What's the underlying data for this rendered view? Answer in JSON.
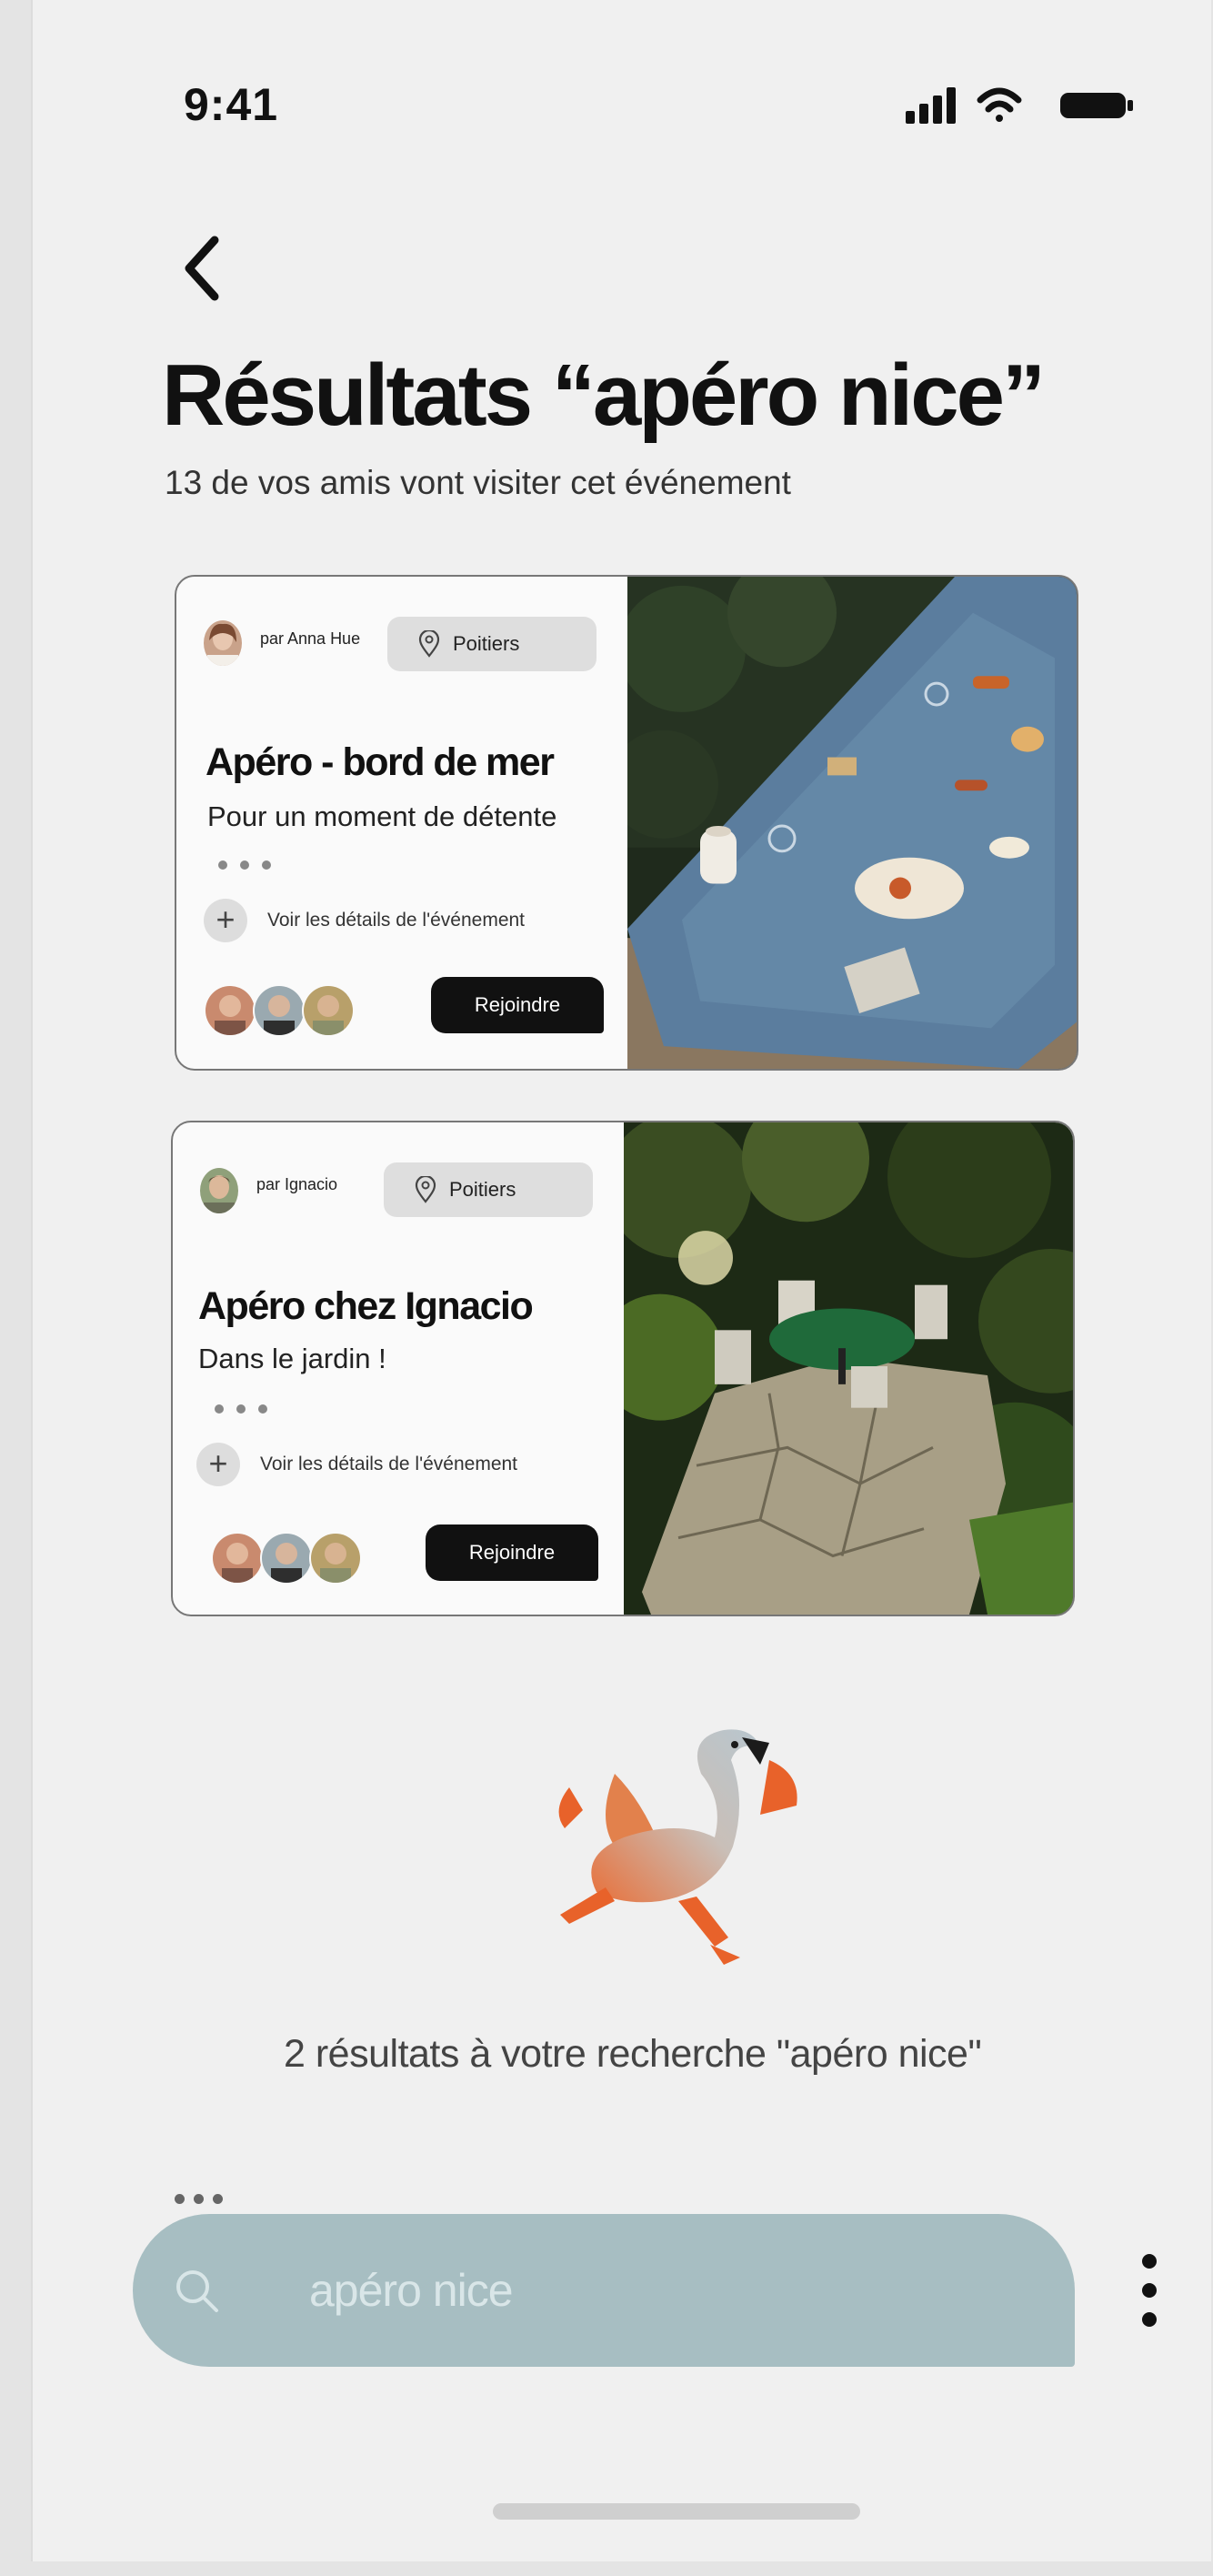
{
  "status_bar": {
    "time": "9:41"
  },
  "header": {
    "back_icon": "chevron-left-icon",
    "title": "Résultats “apéro nice”",
    "subtitle": "13 de vos amis vont visiter cet événement"
  },
  "results": [
    {
      "host": "par Anna Hue",
      "location": "Poitiers",
      "title": "Apéro - bord de mer",
      "description": "Pour un moment de détente",
      "details_link": "Voir les détails de l'événement",
      "join_label": "Rejoindre",
      "image": "picnic-on-blue-blanket-photo"
    },
    {
      "host": "par Ignacio",
      "location": "Poitiers",
      "title": "Apéro chez Ignacio",
      "description": "Dans le jardin !",
      "details_link": "Voir les détails de l'événement",
      "join_label": "Rejoindre",
      "image": "garden-patio-table-photo"
    }
  ],
  "mascot": "flamingo-mascot-illustration",
  "result_count": "2 résultats à votre recherche \"apéro nice\"",
  "search": {
    "value": "apéro nice",
    "icon": "search-icon"
  },
  "more_icon": "vertical-dots-icon",
  "colors": {
    "background": "#f0f0f0",
    "search_bar": "#a7bec2",
    "button": "#111111",
    "mascot_orange": "#e8622a"
  }
}
